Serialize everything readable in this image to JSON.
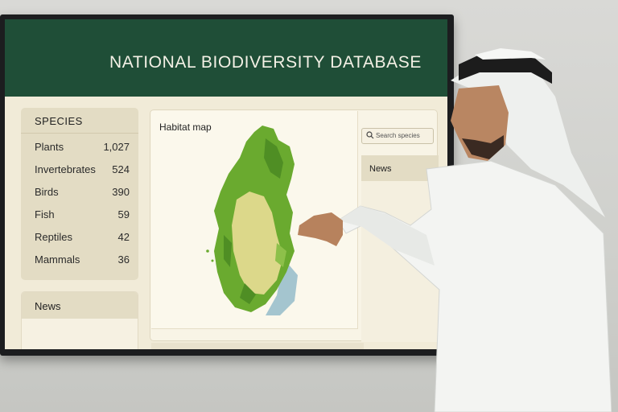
{
  "header": {
    "title": "NATIONAL BIODIVERSITY DATABASE"
  },
  "species": {
    "heading": "SPECIES",
    "items": [
      {
        "label": "Plants",
        "count": "1,027"
      },
      {
        "label": "Invertebrates",
        "count": "524"
      },
      {
        "label": "Birds",
        "count": "390"
      },
      {
        "label": "Fish",
        "count": "59"
      },
      {
        "label": "Reptiles",
        "count": "42"
      },
      {
        "label": "Mammals",
        "count": "36"
      }
    ]
  },
  "news_left": {
    "heading": "News"
  },
  "habitat": {
    "title": "Habitat map"
  },
  "search": {
    "placeholder": "Search species",
    "icon": "search-icon"
  },
  "news_right": {
    "heading": "News"
  },
  "colors": {
    "header_bg": "#1f4e37",
    "panel_bg": "#e3dcc4",
    "screen_bg": "#f1ebd8"
  }
}
